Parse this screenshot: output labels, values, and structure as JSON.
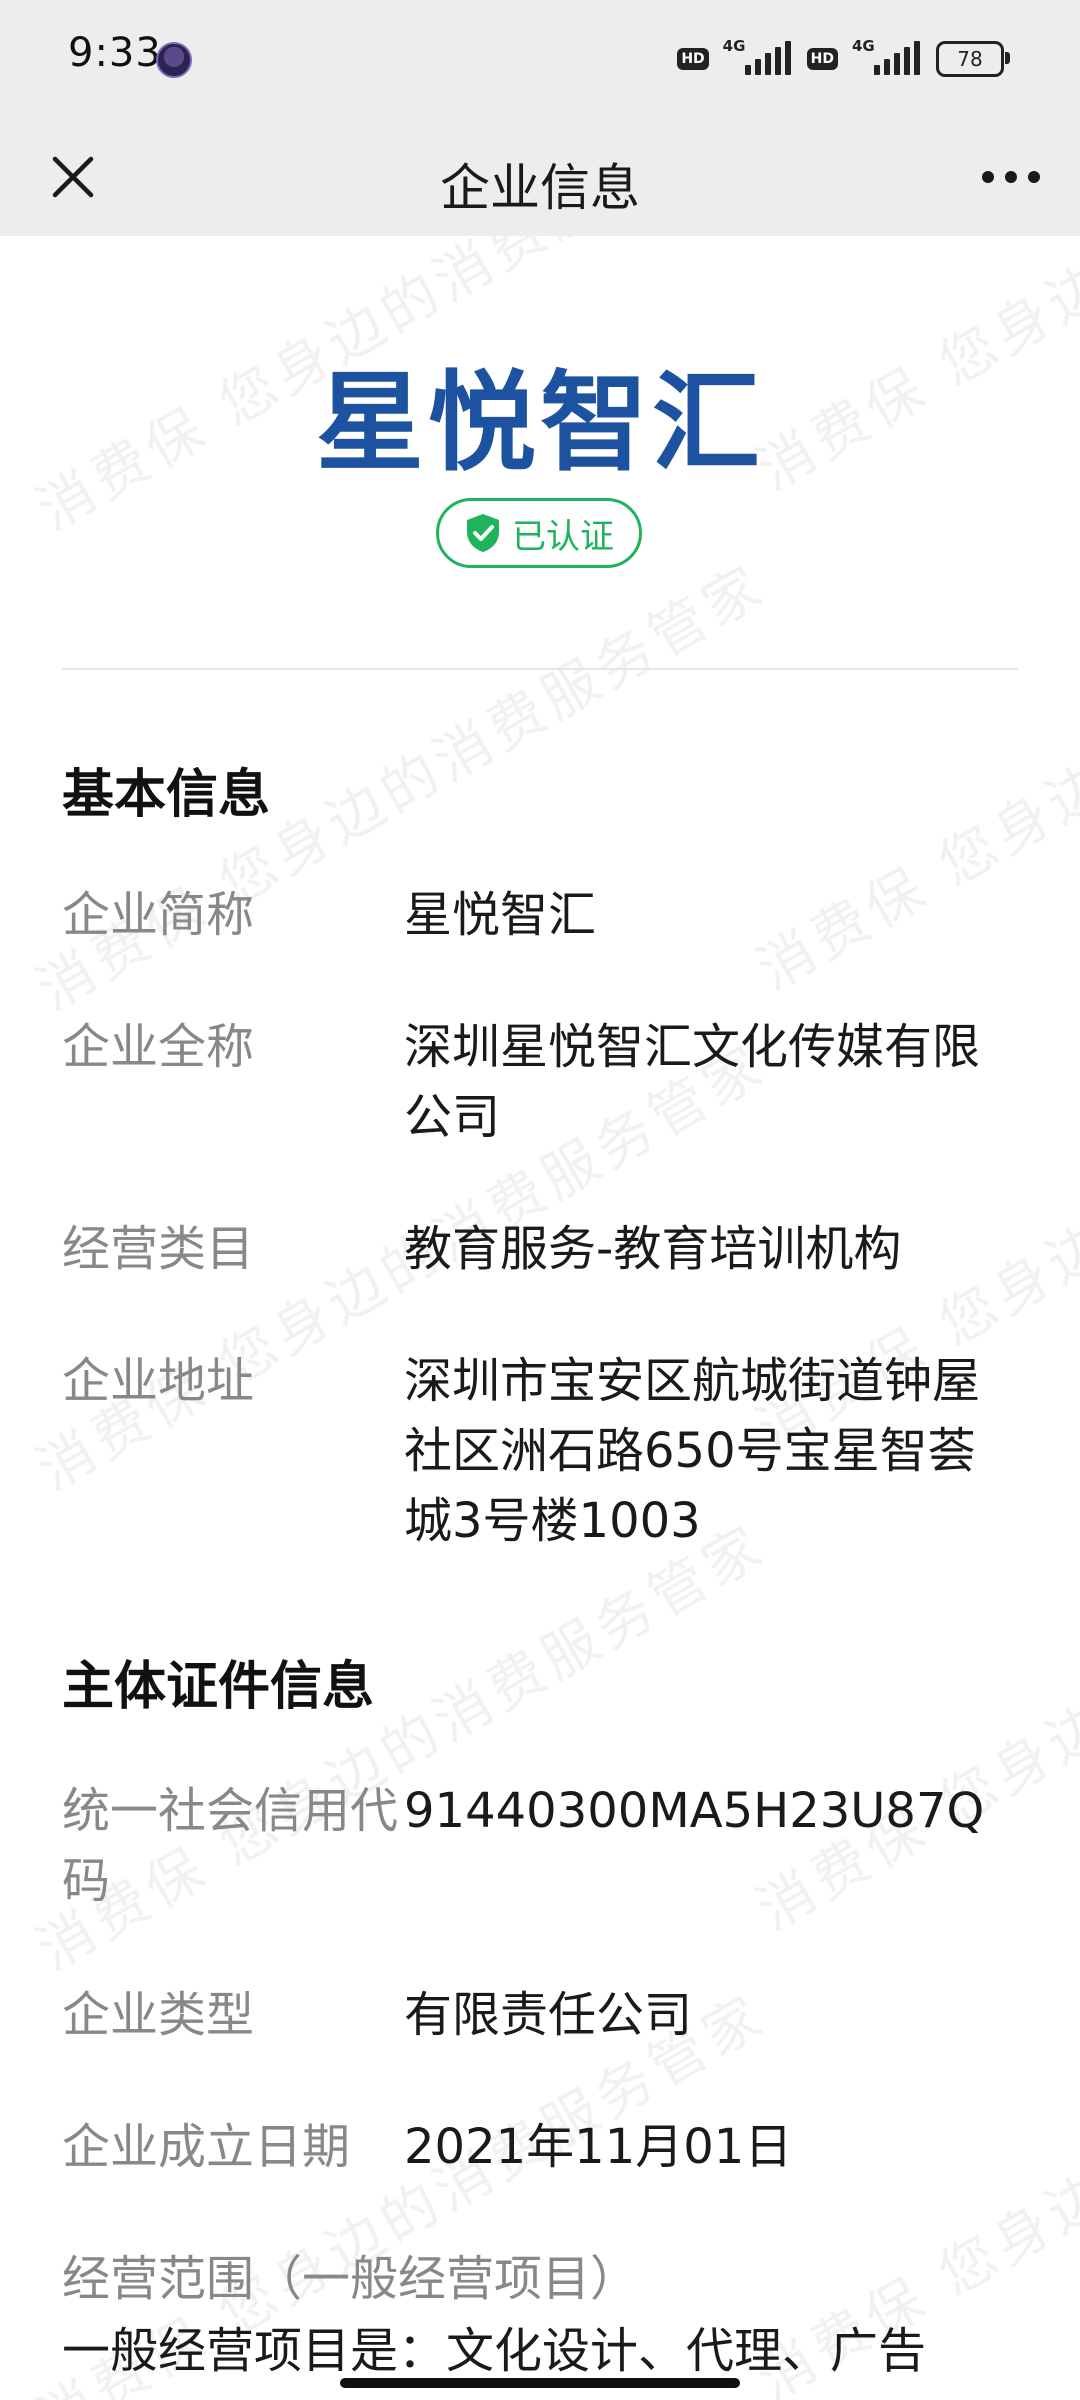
{
  "status_bar": {
    "time": "9:33",
    "network_1": "4G",
    "network_2": "4G",
    "hd_label": "HD",
    "battery": "78"
  },
  "title_bar": {
    "title": "企业信息"
  },
  "company": {
    "short_name_display": "星悦智汇",
    "verified_label": "已认证",
    "accent_color": "#1d52a0",
    "verified_color": "#1fb35b"
  },
  "basic_info": {
    "section_title": "基本信息",
    "rows": [
      {
        "label": "企业简称",
        "value": "星悦智汇"
      },
      {
        "label": "企业全称",
        "value": "深圳星悦智汇文化传媒有限公司"
      },
      {
        "label": "经营类目",
        "value": "教育服务-教育培训机构"
      },
      {
        "label": "企业地址",
        "value": "深圳市宝安区航城街道钟屋社区洲石路650号宝星智荟城3号楼1003"
      }
    ]
  },
  "license_info": {
    "section_title": "主体证件信息",
    "rows": [
      {
        "label": "统一社会信用代码",
        "value": "91440300MA5H23U87Q"
      },
      {
        "label": "企业类型",
        "value": "有限责任公司"
      },
      {
        "label": "企业成立日期",
        "value": "2021年11月01日"
      }
    ],
    "scope_label": "经营范围（一般经营项目）",
    "scope_text_partial": "一般经营项目是：文化设计、代理、广告"
  },
  "watermark": {
    "text": "消费保 您身边的消费服务管家"
  }
}
